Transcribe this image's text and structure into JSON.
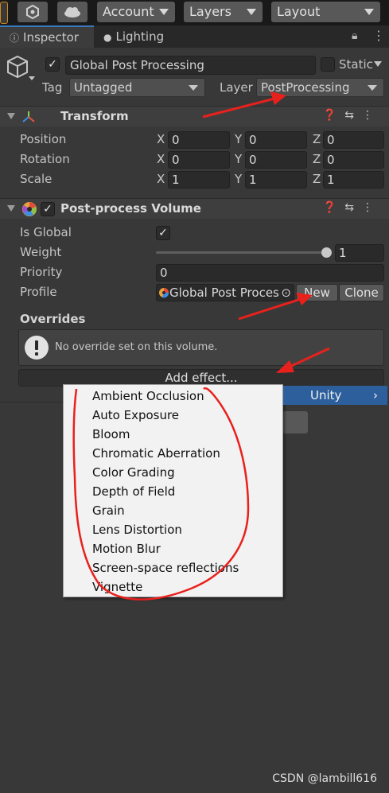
{
  "toolbar": {
    "account_label": "Account",
    "layers_label": "Layers",
    "layout_label": "Layout"
  },
  "tabs": {
    "inspector": "Inspector",
    "lighting": "Lighting"
  },
  "gameobject": {
    "name": "Global Post Processing",
    "static_label": "Static",
    "tag_label": "Tag",
    "tag_value": "Untagged",
    "layer_label": "Layer",
    "layer_value": "PostProcessing"
  },
  "transform": {
    "title": "Transform",
    "rows": [
      {
        "label": "Position",
        "x": "0",
        "y": "0",
        "z": "0"
      },
      {
        "label": "Rotation",
        "x": "0",
        "y": "0",
        "z": "0"
      },
      {
        "label": "Scale",
        "x": "1",
        "y": "1",
        "z": "1"
      }
    ],
    "axis_x": "X",
    "axis_y": "Y",
    "axis_z": "Z"
  },
  "volume": {
    "title": "Post-process Volume",
    "is_global_label": "Is Global",
    "weight_label": "Weight",
    "weight_value": "1",
    "weight_fraction": 1.0,
    "priority_label": "Priority",
    "priority_value": "0",
    "profile_label": "Profile",
    "profile_value": "Global Post Proces",
    "new_label": "New",
    "clone_label": "Clone",
    "overrides_label": "Overrides",
    "no_override_text": "No override set on this volume.",
    "add_effect_label": "Add effect..."
  },
  "menu": {
    "items": [
      "Ambient Occlusion",
      "Auto Exposure",
      "Bloom",
      "Chromatic Aberration",
      "Color Grading",
      "Depth of Field",
      "Grain",
      "Lens Distortion",
      "Motion Blur",
      "Screen-space reflections",
      "Vignette"
    ],
    "submenu_label": "Unity",
    "submenu_arrow": "›"
  },
  "colors": {
    "menu_highlight": "#2d5f9c",
    "annotation_red": "#e8211d"
  },
  "watermark": "CSDN @lambill616"
}
